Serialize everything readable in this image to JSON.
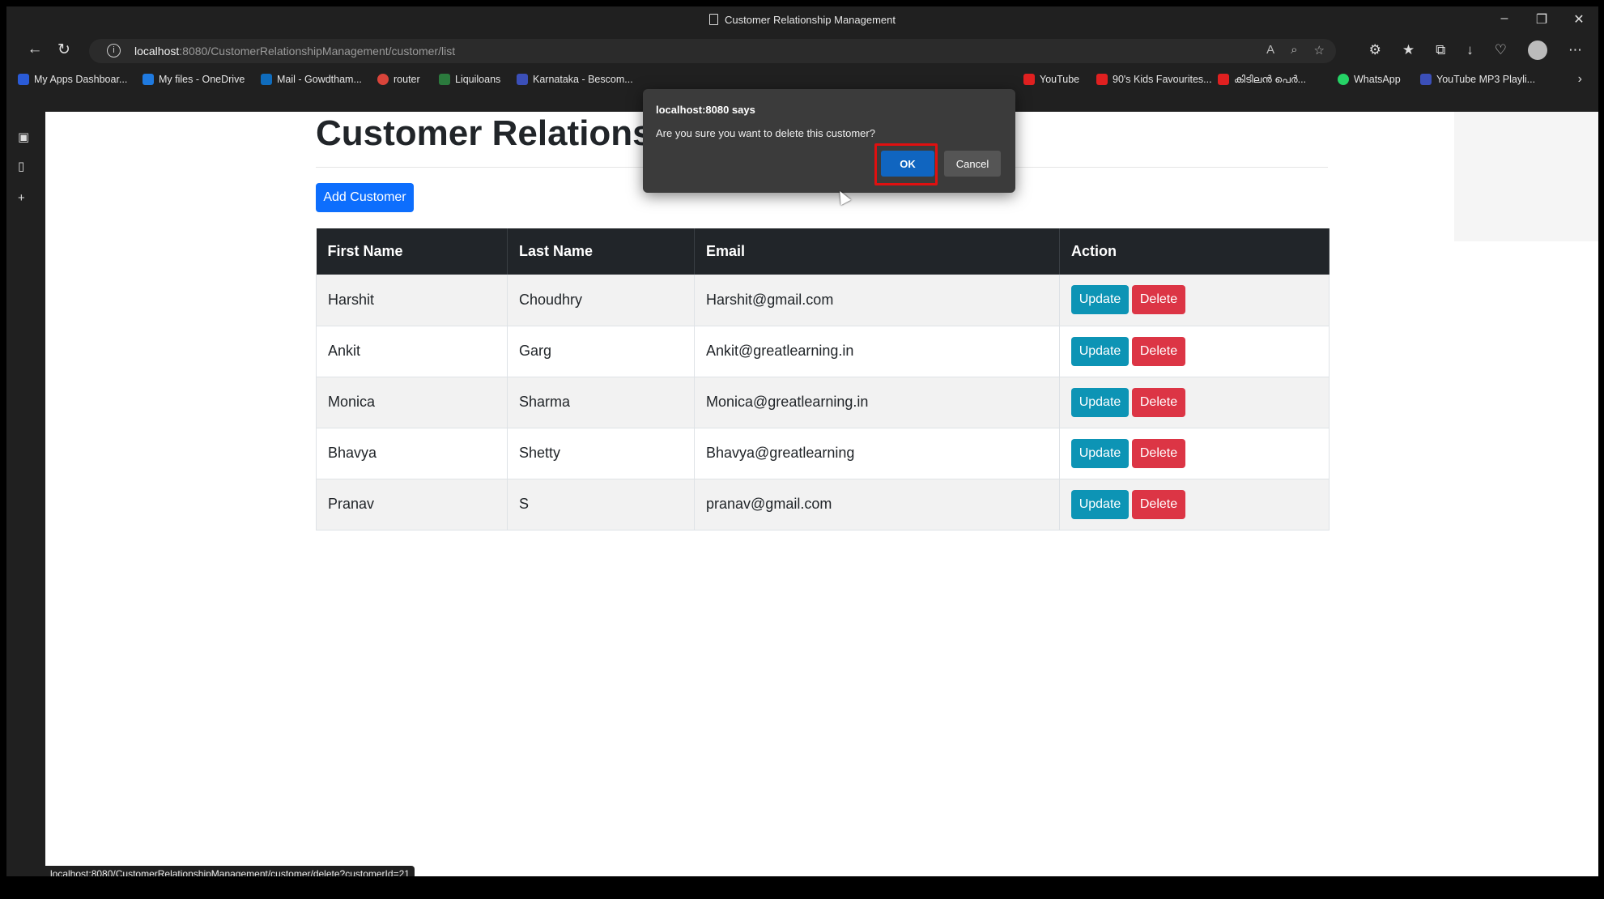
{
  "window": {
    "title": "Customer Relationship Management",
    "controls": [
      "–",
      "❐",
      "✕"
    ]
  },
  "nav": {
    "url_host": "localhost",
    "url_rest": ":8080/CustomerRelationshipManagement/customer/list"
  },
  "bookmarks": [
    {
      "label": "My Apps Dashboar...",
      "color": "#2a5bd7"
    },
    {
      "label": "My files - OneDrive",
      "color": "#1f7ae0"
    },
    {
      "label": "Mail - Gowdtham...",
      "color": "#0f6cbd"
    },
    {
      "label": "router",
      "color": "#d9443a"
    },
    {
      "label": "Liquiloans",
      "color": "#2b7a3d"
    },
    {
      "label": "Karnataka - Bescom...",
      "color": "#3b4fb8"
    },
    {
      "label": "YouTube",
      "color": "#e02020"
    },
    {
      "label": "90's Kids Favourites...",
      "color": "#e02020"
    },
    {
      "label": "കിടിലൻ പെർ...",
      "color": "#e02020"
    },
    {
      "label": "WhatsApp",
      "color": "#25d366"
    },
    {
      "label": "YouTube MP3 Playli...",
      "color": "#3b4fb8"
    }
  ],
  "page": {
    "title": "Customer Relations",
    "add_button": "Add Customer"
  },
  "table": {
    "headers": [
      "First Name",
      "Last Name",
      "Email",
      "Action"
    ],
    "rows": [
      {
        "first": "Harshit",
        "last": "Choudhry",
        "email": "Harshit@gmail.com"
      },
      {
        "first": "Ankit",
        "last": "Garg",
        "email": "Ankit@greatlearning.in"
      },
      {
        "first": "Monica",
        "last": "Sharma",
        "email": "Monica@greatlearning.in"
      },
      {
        "first": "Bhavya",
        "last": "Shetty",
        "email": "Bhavya@greatlearning"
      },
      {
        "first": "Pranav",
        "last": "S",
        "email": "pranav@gmail.com"
      }
    ],
    "update_label": "Update",
    "delete_label": "Delete"
  },
  "dialog": {
    "title": "localhost:8080 says",
    "message": "Are you sure you want to delete this customer?",
    "ok": "OK",
    "cancel": "Cancel"
  },
  "status_url": "localhost:8080/CustomerRelationshipManagement/customer/delete?customerId=21",
  "colors": {
    "primary": "#0d6efd",
    "info": "#0d94b5",
    "danger": "#dc3545",
    "table_header": "#212529",
    "dialog_ok": "#1065c0",
    "highlight": "#e01010"
  }
}
